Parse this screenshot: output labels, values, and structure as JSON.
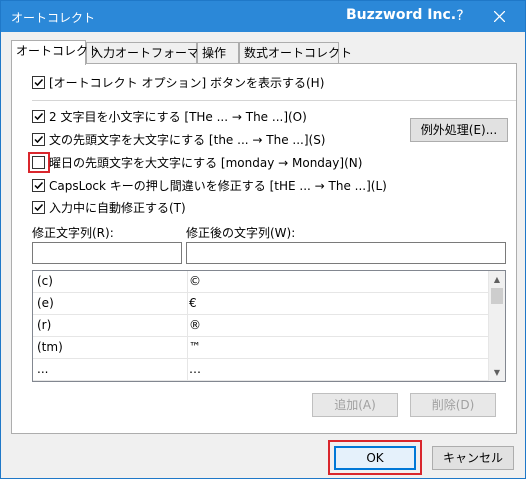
{
  "titlebar": {
    "title": "オートコレクト",
    "brand": "Buzzword Inc.",
    "help": "?"
  },
  "tabs": [
    {
      "label": "オートコレクト",
      "active": true
    },
    {
      "label": "入力オートフォーマット",
      "active": false
    },
    {
      "label": "操作",
      "active": false
    },
    {
      "label": "数式オートコレクト",
      "active": false
    }
  ],
  "options": {
    "show_buttons": {
      "label": "[オートコレクト オプション] ボタンを表示する(H)",
      "checked": true
    },
    "two_initial_caps": {
      "label": "2 文字目を小文字にする [THe ... → The ...](O)",
      "checked": true
    },
    "capitalize_sentence": {
      "label": "文の先頭文字を大文字にする [the ... → The ...](S)",
      "checked": true
    },
    "capitalize_days": {
      "label": "曜日の先頭文字を大文字にする [monday → Monday](N)",
      "checked": false
    },
    "capslock": {
      "label": "CapsLock キーの押し間違いを修正する [tHE ... → The ...](L)",
      "checked": true
    },
    "replace_text": {
      "label": "入力中に自動修正する(T)",
      "checked": true
    }
  },
  "exceptions_button": "例外処理(E)...",
  "replace_label": "修正文字列(R):",
  "with_label": "修正後の文字列(W):",
  "replace_value": "",
  "with_value": "",
  "entries": [
    {
      "from": "(c)",
      "to": "©"
    },
    {
      "from": "(e)",
      "to": "€"
    },
    {
      "from": "(r)",
      "to": "®"
    },
    {
      "from": "(tm)",
      "to": "™"
    },
    {
      "from": "...",
      "to": "…"
    }
  ],
  "add_button": "追加(A)",
  "delete_button": "削除(D)",
  "ok_button": "OK",
  "cancel_button": "キャンセル"
}
